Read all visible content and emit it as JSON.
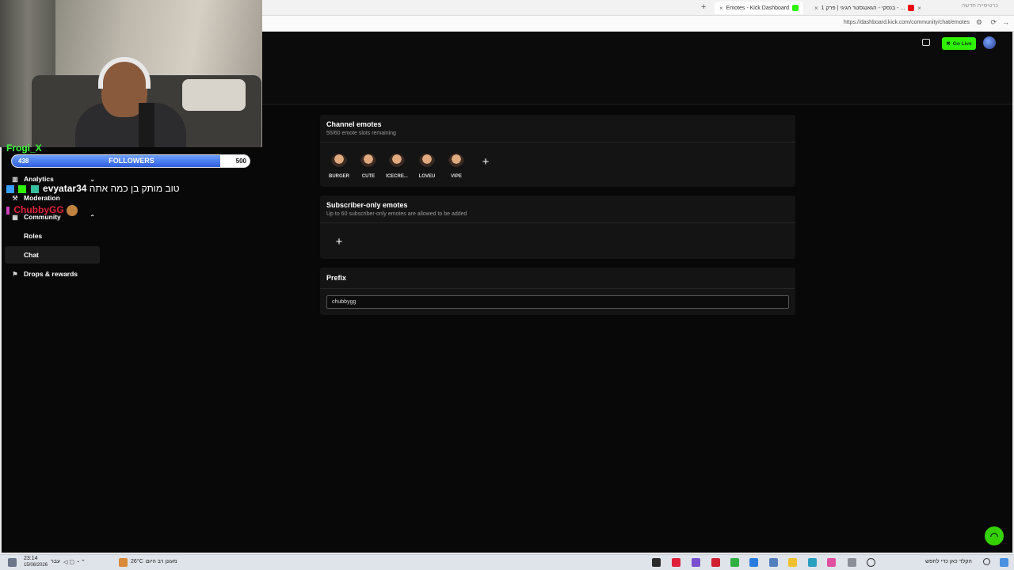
{
  "browser": {
    "tabs": [
      {
        "label": "Emotes - Kick Dashboard",
        "active": true
      },
      {
        "label": "בנסקי - הגאנגסטר הגיגי | פרק 1 - ...",
        "active": false
      }
    ],
    "url": "https://dashboard.kick.com/community/chat/emotes",
    "new_tab_label": "+",
    "close_label": "×",
    "window_hint": "כרטיסייה חדשה"
  },
  "topbar": {
    "go_live_label": "Go Live"
  },
  "sidebar": {
    "items": [
      {
        "label": "Analytics",
        "icon": "chart-icon"
      },
      {
        "label": "Moderation",
        "icon": "hammer-icon"
      },
      {
        "label": "Community",
        "icon": "people-icon"
      },
      {
        "label": "Roles",
        "icon": ""
      },
      {
        "label": "Chat",
        "icon": ""
      },
      {
        "label": "Drops & rewards",
        "icon": "gift-icon"
      }
    ]
  },
  "channel_emotes": {
    "title": "Channel emotes",
    "subtitle": "55/60 emote slots remaining",
    "emotes": [
      "BURGER",
      "CUTE",
      "ICECRE...",
      "LOVEU",
      "VIPE"
    ],
    "add_label": "+"
  },
  "subscriber_emotes": {
    "title": "Subscriber-only emotes",
    "subtitle": "Up to 60 subscriber-only emotes are allowed to be added",
    "add_label": "+"
  },
  "prefix": {
    "title": "Prefix",
    "value": "chubbygg"
  },
  "overlay": {
    "followers": {
      "label": "FOLLOWERS",
      "current": "438",
      "goal": "500",
      "progress": 0.876
    },
    "chat": [
      {
        "user": "Frogi_X",
        "text": "",
        "color": "#3dff3d"
      },
      {
        "user": "evyatar34",
        "text": "טוב מותק בן כמה אתה",
        "color": "#ffffff"
      },
      {
        "user": "ChubbyGG",
        "text": "",
        "color": "#e0203a"
      }
    ]
  },
  "taskbar": {
    "time": "23:14",
    "date": "15/08/2026",
    "weather": "26°C",
    "weather_text": "מעונן רב היום",
    "lang": "עבר",
    "search_placeholder": "הקלד כאן כדי לחפש"
  },
  "colors": {
    "accent": "#2ff200",
    "page_bg": "#080808",
    "card_bg": "#141414"
  }
}
